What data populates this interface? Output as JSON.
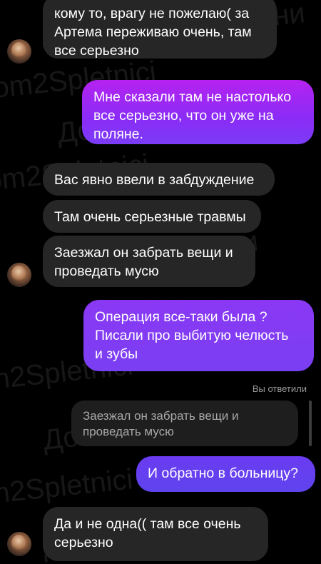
{
  "messages": {
    "m1": "кому то, врагу не пожелаю( за\nАртема переживаю очень, там\nвсе серьезно",
    "m2": "Мне сказали там не настолько\nвсе серьезно, что он уже на\nполяне.",
    "m3": "Вас явно ввели в забдуждение",
    "m4": "Там очень серьезные травмы",
    "m5": "Заезжал он забрать вещи и\nпроведать мусю",
    "m6": "Операция все-таки была ?\nПисали про выбитую челюсть\nи зубы",
    "m7": "И обратно в больницу?",
    "m8": "Да и не одна(( там все очень\nсерьезно"
  },
  "reply": {
    "label": "Вы ответили",
    "quote": "Заезжал он забрать вещи и\nпроведать мусю"
  },
  "watermark": {
    "lines": [
      "Дом2 Сплетни",
      "om2Spletnici",
      "Дом2 \"Сплетни",
      "om2Spletnici",
      "Дом2 \"Сплетни",
      "m2Spletnici",
      "Дом2 \"Сплетни",
      "m2Spletnici",
      "Дом2 \"Сплетни"
    ]
  }
}
